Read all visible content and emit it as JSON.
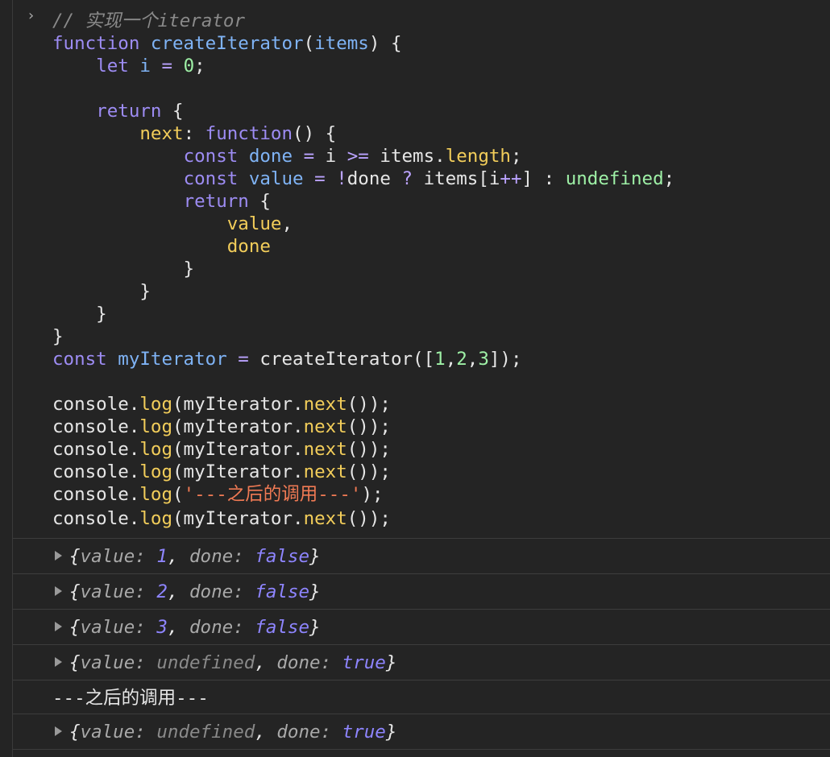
{
  "console": {
    "prompt_glyph": "›",
    "code_lines": [
      "// 实现一个iterator",
      "function createIterator(items) {",
      "    let i = 0;",
      "",
      "    return {",
      "        next: function() {",
      "            const done = i >= items.length;",
      "            const value = !done ? items[i++] : undefined;",
      "            return {",
      "                value,",
      "                done",
      "            }",
      "        }",
      "    }",
      "}",
      "const myIterator = createIterator([1,2,3]);",
      "",
      "console.log(myIterator.next());",
      "console.log(myIterator.next());",
      "console.log(myIterator.next());",
      "console.log(myIterator.next());",
      "console.log('---之后的调用---');",
      "console.log(myIterator.next());"
    ],
    "outputs": [
      {
        "kind": "object",
        "value_key": "value",
        "value": "1",
        "value_type": "number",
        "done_key": "done",
        "done": "false"
      },
      {
        "kind": "object",
        "value_key": "value",
        "value": "2",
        "value_type": "number",
        "done_key": "done",
        "done": "false"
      },
      {
        "kind": "object",
        "value_key": "value",
        "value": "3",
        "value_type": "number",
        "done_key": "done",
        "done": "false"
      },
      {
        "kind": "object",
        "value_key": "value",
        "value": "undefined",
        "value_type": "undefined",
        "done_key": "done",
        "done": "true"
      },
      {
        "kind": "text",
        "text": "---之后的调用---"
      },
      {
        "kind": "object",
        "value_key": "value",
        "value": "undefined",
        "value_type": "undefined",
        "done_key": "done",
        "done": "true"
      }
    ]
  },
  "colors": {
    "background": "#242424",
    "keyword": "#9d8cf3",
    "identifier": "#7fb3f5",
    "property": "#f2cd5a",
    "number": "#9ef0a6",
    "string": "#f07a54",
    "comment": "#8a8a8a",
    "literal_value": "#8e85ff"
  },
  "icons": {
    "prompt": "chevron-right-icon",
    "expand": "triangle-right-icon"
  }
}
